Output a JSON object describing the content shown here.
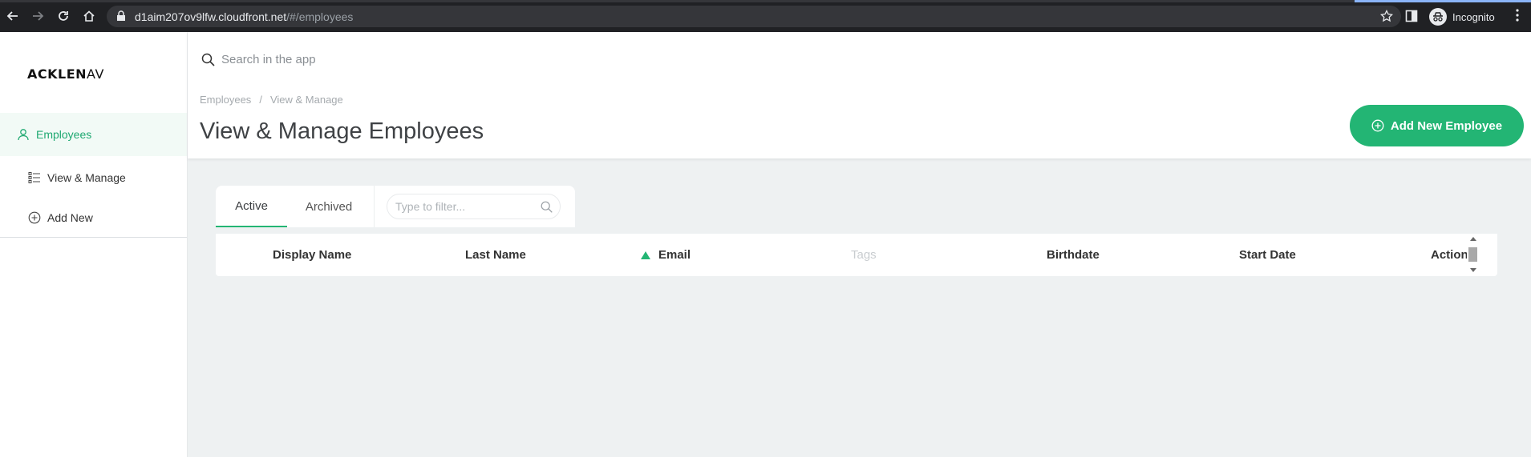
{
  "browser": {
    "url_host": "d1aim207ov9lfw.cloudfront.net",
    "url_path": "/#/employees",
    "profile_label": "Incognito"
  },
  "sidebar": {
    "logo_bold": "ACKLEN",
    "logo_light": "AV",
    "items": [
      {
        "label": "Employees",
        "icon": "user-icon"
      },
      {
        "label": "View & Manage",
        "icon": "list-icon"
      },
      {
        "label": "Add New",
        "icon": "plus-circle-icon"
      }
    ]
  },
  "header": {
    "search_placeholder": "Search in the app",
    "breadcrumb": [
      "Employees",
      "/",
      "View & Manage"
    ],
    "title": "View & Manage Employees",
    "add_button_label": "Add New Employee"
  },
  "tabs": [
    {
      "label": "Active",
      "selected": true
    },
    {
      "label": "Archived",
      "selected": false
    }
  ],
  "filter": {
    "placeholder": "Type to filter..."
  },
  "table": {
    "columns": [
      "Display Name",
      "Last Name",
      "Email",
      "Tags",
      "Birthdate",
      "Start Date",
      "Action"
    ],
    "sorted_column": "Email",
    "sort_direction": "ascending"
  },
  "colors": {
    "accent": "#23b574",
    "active_text": "#1fa971",
    "active_bg": "#f2faf6",
    "content_bg": "#eef1f2"
  }
}
